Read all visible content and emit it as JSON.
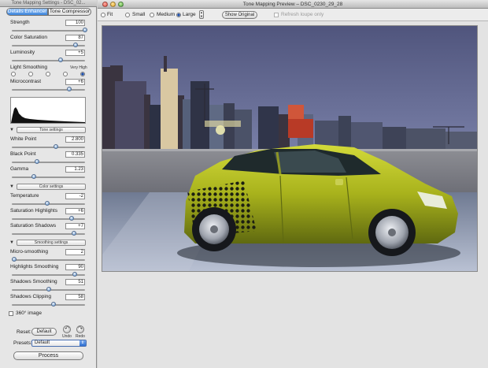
{
  "left_window": {
    "title": "Tone Mapping Settings - DSC_02...",
    "tabs": [
      {
        "label": "Details Enhancer",
        "selected": true
      },
      {
        "label": "Tone Compressor",
        "selected": false
      }
    ],
    "strength": {
      "label": "Strength",
      "value": "100",
      "level": 1.0
    },
    "color_saturation": {
      "label": "Color Saturation",
      "value": "87",
      "level": 0.87
    },
    "luminosity": {
      "label": "Luminosity",
      "value": "+5",
      "level": 0.67
    },
    "light_smoothing": {
      "label": "Light Smoothing",
      "hint": "Very High",
      "selected_index": 4
    },
    "microcontrast": {
      "label": "Microcontrast",
      "value": "+6",
      "level": 0.78
    },
    "tone_settings": {
      "header": "Tone settings",
      "white_point": {
        "label": "White Point",
        "value": "2.800",
        "level": 0.6
      },
      "black_point": {
        "label": "Black Point",
        "value": "0.335",
        "level": 0.34
      },
      "gamma": {
        "label": "Gamma",
        "value": "1.23",
        "level": 0.3
      }
    },
    "color_settings": {
      "header": "Color settings",
      "temperature": {
        "label": "Temperature",
        "value": "-2",
        "level": 0.48
      },
      "saturation_highlights": {
        "label": "Saturation Highlights",
        "value": "+6",
        "level": 0.82
      },
      "saturation_shadows": {
        "label": "Saturation Shadows",
        "value": "+7",
        "level": 0.85
      }
    },
    "smoothing_settings": {
      "header": "Smoothing settings",
      "micro_smoothing": {
        "label": "Micro-smoothing",
        "value": "2",
        "level": 0.03
      },
      "highlights_smoothing": {
        "label": "Highlights Smoothing",
        "value": "90",
        "level": 0.86
      },
      "shadows_smoothing": {
        "label": "Shadows Smoothing",
        "value": "51",
        "level": 0.5
      },
      "shadows_clipping": {
        "label": "Shadows Clipping",
        "value": "58",
        "level": 0.57
      }
    },
    "image_360": {
      "label": "360° image",
      "checked": false
    },
    "reset": {
      "label": "Reset:",
      "default_button": "Default",
      "undo": "Undo",
      "redo": "Redo"
    },
    "presets": {
      "label": "Presets:",
      "value": "Default"
    },
    "process_button": "Process"
  },
  "right_window": {
    "title": "Tone Mapping Preview – DSC_0230_29_28",
    "zoom_options": [
      {
        "label": "Fit",
        "selected": false
      },
      {
        "label": "Small",
        "selected": false
      },
      {
        "label": "Medium",
        "selected": false
      },
      {
        "label": "Large",
        "selected": true
      }
    ],
    "show_original_button": "Show Original",
    "refresh_loupe": {
      "label": "Refresh loupe only",
      "checked": false,
      "enabled": false
    },
    "preview_description_icon": "hdr-car-photo"
  },
  "colors": {
    "accent": "#3e86de",
    "car_body": "#a9b41c",
    "sky_top": "#5b5f86",
    "sky_bottom": "#9aa7c8"
  }
}
